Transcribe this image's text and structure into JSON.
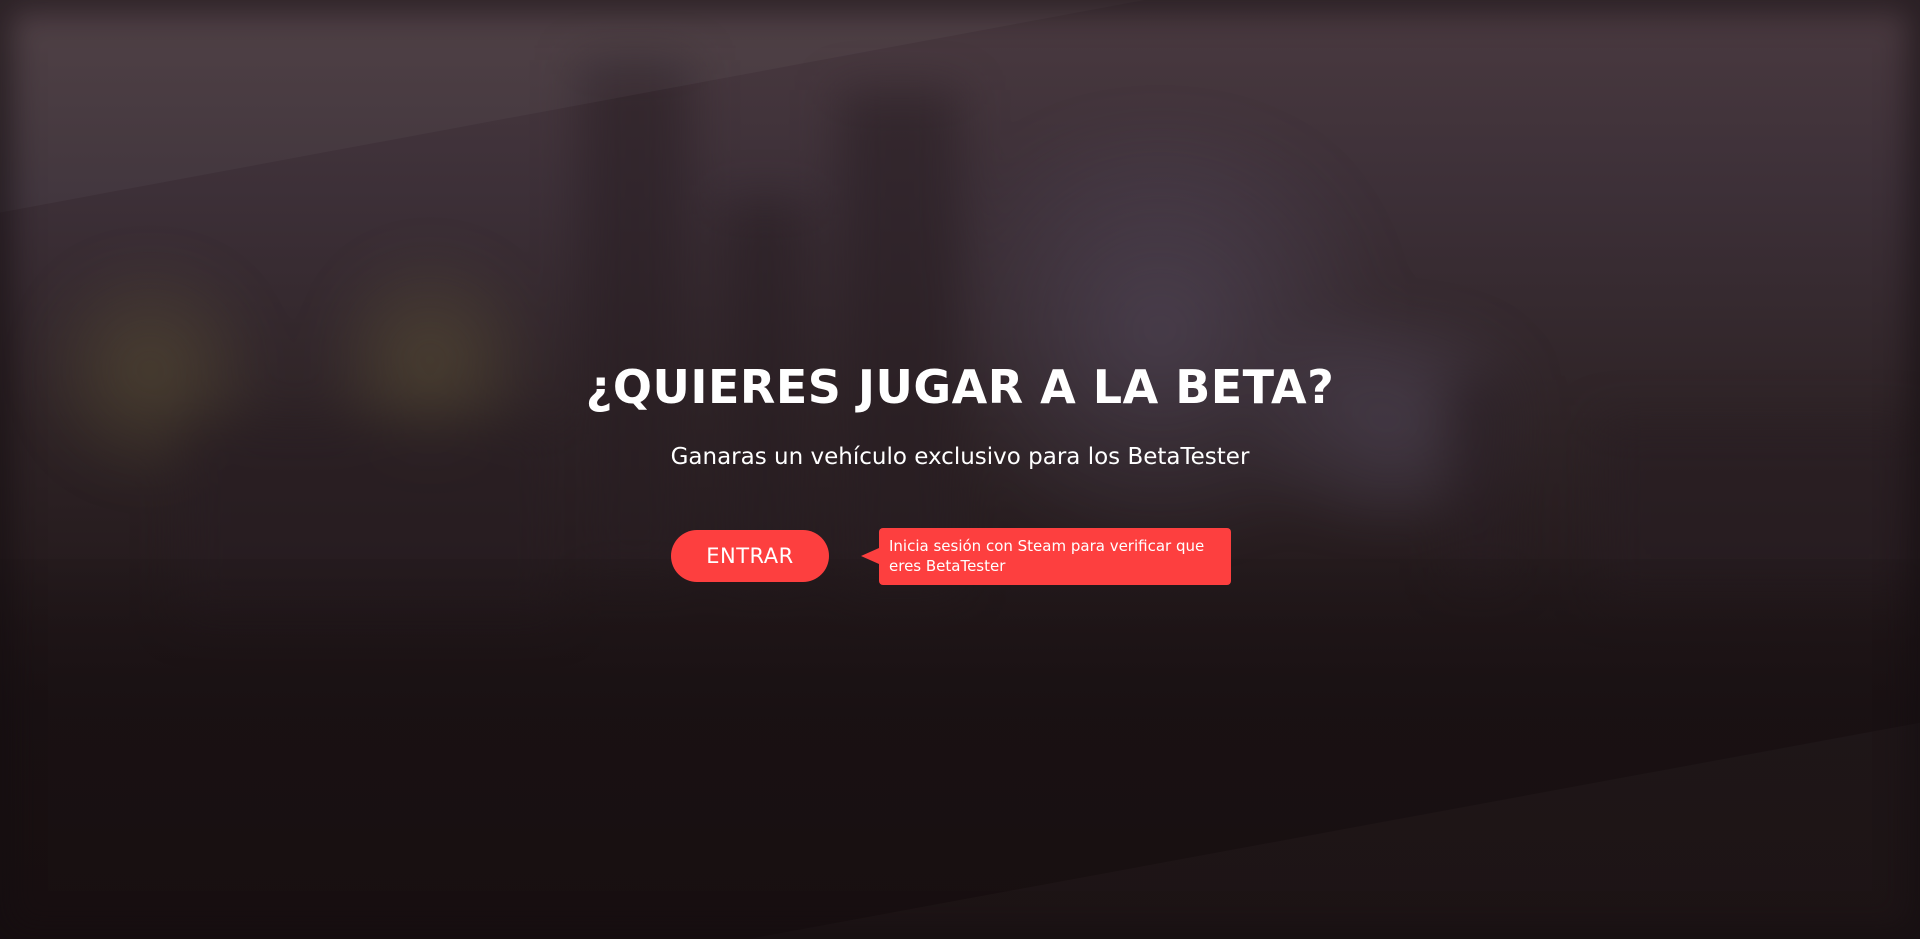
{
  "hero": {
    "title": "¿QUIERES JUGAR A LA BETA?",
    "subtitle": "Ganaras un vehículo exclusivo para los BetaTester"
  },
  "actions": {
    "enter_label": "ENTRAR",
    "tooltip_text": "Inicia sesión con Steam para verificar que eres BetaTester"
  },
  "colors": {
    "accent": "#fd3f3f",
    "text": "#ffffff",
    "background": "#2e2326"
  }
}
